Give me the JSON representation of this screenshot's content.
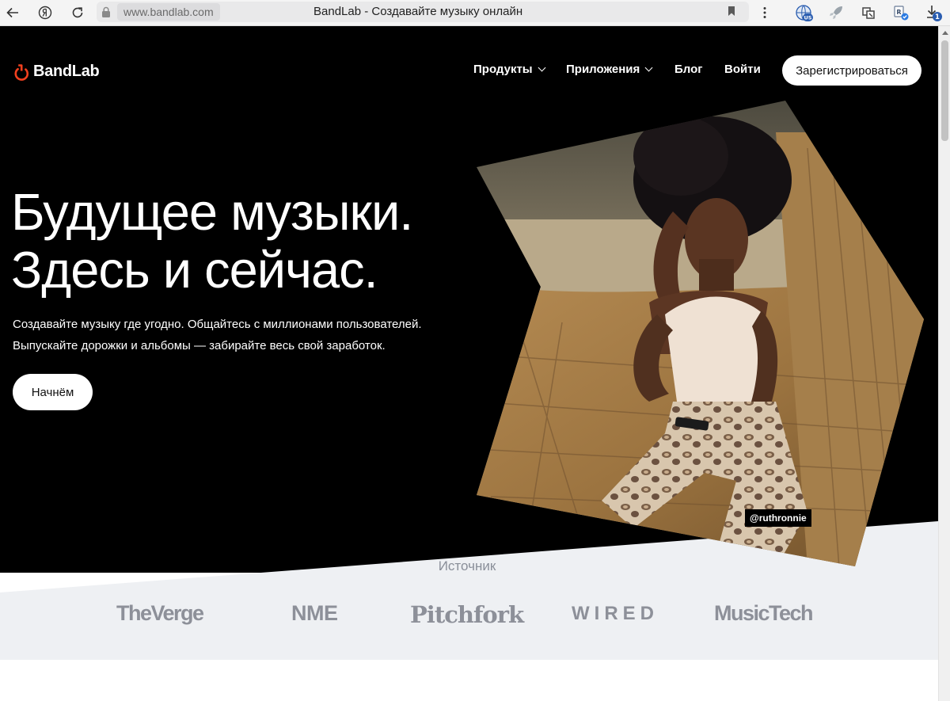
{
  "browser": {
    "url_host": "www.bandlab.com",
    "tab_title": "BandLab - Создавайте музыку онлайн",
    "extension_badge": "US",
    "download_count": "1"
  },
  "header": {
    "logo_text": "BandLab",
    "nav": {
      "products": "Продукты",
      "apps": "Приложения",
      "blog": "Блог",
      "login": "Войти"
    },
    "signup_label": "Зарегистрироваться"
  },
  "hero": {
    "headline_line1": "Будущее музыки.",
    "headline_line2": "Здесь и сейчас.",
    "subtitle_line1": "Создавайте музыку где угодно. Общайтесь с миллионами пользователей.",
    "subtitle_line2": "Выпускайте дорожки и альбомы — забирайте весь свой заработок.",
    "cta_label": "Начнём",
    "photo_credit": "@ruthronnie"
  },
  "press": {
    "label": "Источник",
    "logos": [
      "TheVerge",
      "NME",
      "Pitchfork",
      "WIRED",
      "MusicTech"
    ]
  },
  "colors": {
    "brand_red": "#f2401e",
    "hero_bg": "#000000",
    "press_bg": "#eef0f3",
    "press_logo": "#8d9099"
  }
}
